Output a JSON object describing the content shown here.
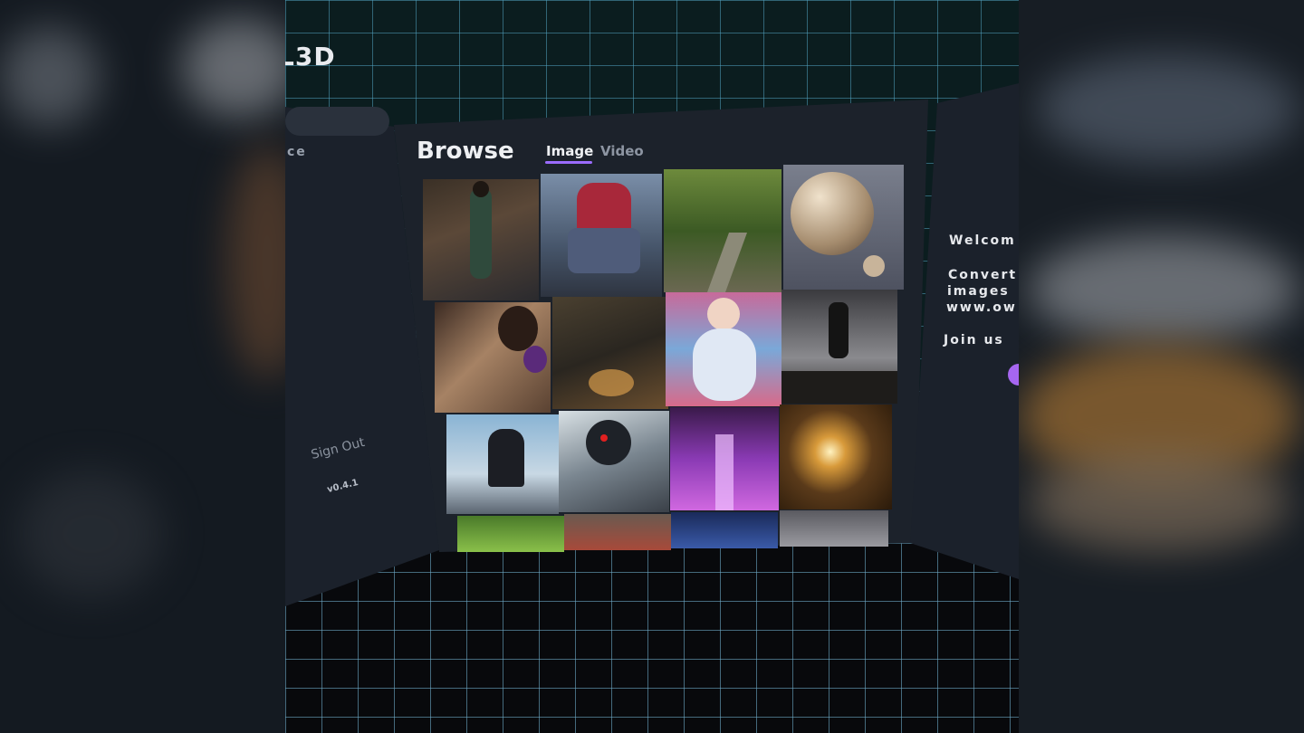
{
  "sidebar": {
    "logo": "L3D",
    "partial_item": "ce",
    "sign_out": "Sign Out",
    "version": "v0.4.1"
  },
  "browse": {
    "title": "Browse",
    "tabs": [
      {
        "label": "Image",
        "active": true
      },
      {
        "label": "Video",
        "active": false
      }
    ],
    "accent_color": "#9b6cff"
  },
  "welcome": {
    "heading": "Welcom",
    "line1": "Convert",
    "line2": "images",
    "line3": "www.ow",
    "join": "Join us"
  }
}
